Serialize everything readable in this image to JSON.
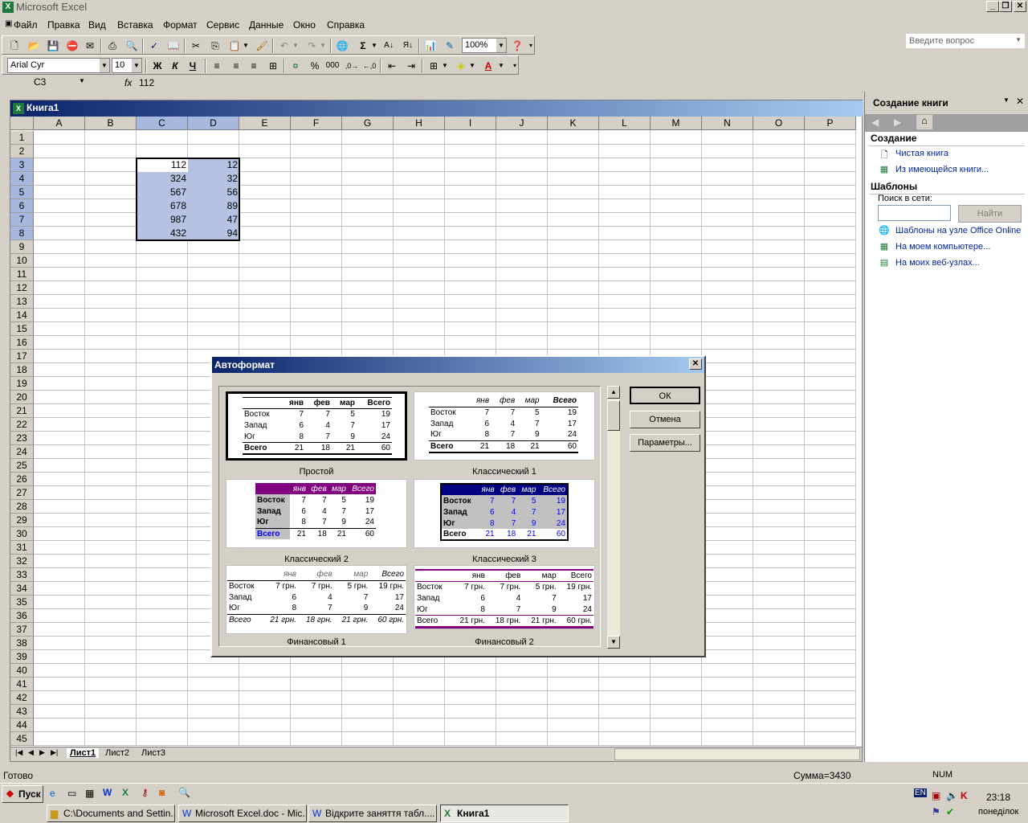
{
  "window": {
    "title": "Microsoft Excel"
  },
  "menu": [
    "Файл",
    "Правка",
    "Вид",
    "Вставка",
    "Формат",
    "Сервис",
    "Данные",
    "Окно",
    "Справка"
  ],
  "ask_placeholder": "Введите вопрос",
  "toolbar": {
    "zoom": "100%",
    "font": "Arial Cyr",
    "size": "10",
    "bold": "Ж",
    "italic": "К",
    "underline": "Ч",
    "sigma": "Σ"
  },
  "formula": {
    "cell": "C3",
    "fx": "fx",
    "value": "112"
  },
  "workbook": {
    "title": "Книга1"
  },
  "columns": [
    "A",
    "B",
    "C",
    "D",
    "E",
    "F",
    "G",
    "H",
    "I",
    "J",
    "K",
    "L",
    "M",
    "N",
    "O",
    "P"
  ],
  "rows": [
    "1",
    "2",
    "3",
    "4",
    "5",
    "6",
    "7",
    "8",
    "9",
    "10",
    "11",
    "12",
    "13",
    "14",
    "15",
    "16",
    "17",
    "18",
    "19",
    "20",
    "21",
    "22",
    "23",
    "24",
    "25",
    "26",
    "27",
    "28",
    "29",
    "30",
    "31",
    "32",
    "33",
    "34",
    "35",
    "36",
    "37",
    "38",
    "39",
    "40",
    "41",
    "42",
    "43",
    "44",
    "45"
  ],
  "cells": [
    {
      "c": "112",
      "d": "12"
    },
    {
      "c": "324",
      "d": "32"
    },
    {
      "c": "567",
      "d": "56"
    },
    {
      "c": "678",
      "d": "89"
    },
    {
      "c": "987",
      "d": "47"
    },
    {
      "c": "432",
      "d": "94"
    }
  ],
  "sheets": [
    "Лист1",
    "Лист2",
    "Лист3"
  ],
  "taskpane": {
    "title": "Создание книги",
    "sec1": "Создание",
    "blank": "Чистая книга",
    "existing": "Из имеющейся книги...",
    "sec2": "Шаблоны",
    "search_label": "Поиск в сети:",
    "search_btn": "Найти",
    "t1": "Шаблоны на узле Office Online",
    "t2": "На моем компьютере...",
    "t3": "На моих веб-узлах..."
  },
  "dialog": {
    "title": "Автоформат",
    "ok": "ОК",
    "cancel": "Отмена",
    "params": "Параметры...",
    "formats": [
      "Простой",
      "Классический 1",
      "Классический 2",
      "Классический 3",
      "Финансовый 1",
      "Финансовый 2"
    ],
    "hdr": [
      "янв",
      "фев",
      "мар",
      "Всего"
    ],
    "rows": [
      [
        "Восток",
        "7",
        "7",
        "5",
        "19"
      ],
      [
        "Запад",
        "6",
        "4",
        "7",
        "17"
      ],
      [
        "Юг",
        "8",
        "7",
        "9",
        "24"
      ],
      [
        "Всего",
        "21",
        "18",
        "21",
        "60"
      ]
    ],
    "rows_fin": [
      [
        "Восток",
        "7 грн.",
        "7 грн.",
        "5 грн.",
        "19 грн."
      ],
      [
        "Запад",
        "6",
        "4",
        "7",
        "17"
      ],
      [
        "Юг",
        "8",
        "7",
        "9",
        "24"
      ],
      [
        "Всего",
        "21 грн.",
        "18 грн.",
        "21 грн.",
        "60 грн."
      ]
    ]
  },
  "status": {
    "left": "Готово",
    "sum": "Сумма=3430",
    "num": "NUM"
  },
  "taskbar": {
    "start": "Пуск",
    "items": [
      "C:\\Documents and Settin...",
      "Microsoft Excel.doc - Mic...",
      "Відкрите заняття табл....",
      "Книга1"
    ],
    "lang": "EN",
    "time": "23:18",
    "day": "понеділок"
  }
}
